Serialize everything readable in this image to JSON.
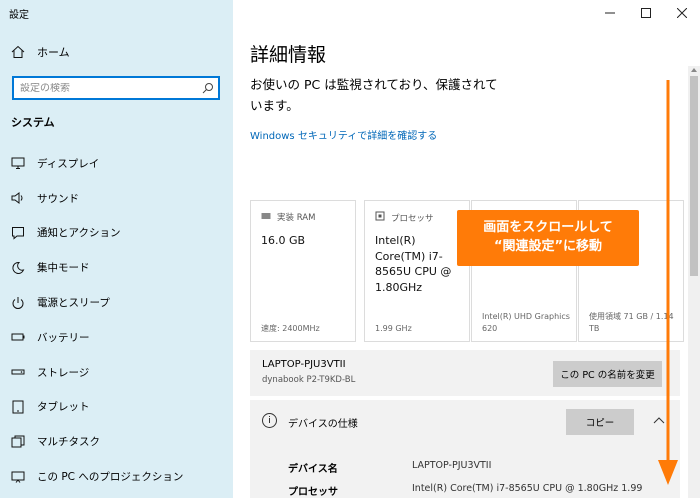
{
  "app": {
    "title": "設定"
  },
  "sidebar": {
    "home_label": "ホーム",
    "search_placeholder": "設定の検索",
    "section_title": "システム",
    "items": [
      {
        "label": "ディスプレイ",
        "icon": "monitor-icon"
      },
      {
        "label": "サウンド",
        "icon": "speaker-icon"
      },
      {
        "label": "通知とアクション",
        "icon": "notification-icon"
      },
      {
        "label": "集中モード",
        "icon": "moon-icon"
      },
      {
        "label": "電源とスリープ",
        "icon": "power-icon"
      },
      {
        "label": "バッテリー",
        "icon": "battery-icon"
      },
      {
        "label": "ストレージ",
        "icon": "storage-icon"
      },
      {
        "label": "タブレット",
        "icon": "tablet-icon"
      },
      {
        "label": "マルチタスク",
        "icon": "multitask-icon"
      },
      {
        "label": "この PC へのプロジェクション",
        "icon": "projection-icon"
      }
    ]
  },
  "main": {
    "title": "詳細情報",
    "status_text": "お使いの PC は監視されており、保護されています。",
    "security_link": "Windows セキュリティで詳細を確認する",
    "cards": [
      {
        "head": "実装 RAM",
        "icon": "ram-icon",
        "value": "16.0 GB",
        "sub": "速度: 2400MHz"
      },
      {
        "head": "プロセッサ",
        "icon": "processor-icon",
        "value": "Intel(R) Core(TM) i7-8565U CPU @ 1.80GHz",
        "sub": "1.99 GHz"
      },
      {
        "head": "",
        "icon": "",
        "value": "",
        "sub": "Intel(R) UHD Graphics 620"
      },
      {
        "head": "",
        "icon": "",
        "value": "",
        "sub": "使用領域 71 GB / 1.14 TB"
      }
    ],
    "callout": {
      "line1": "画面をスクロールして",
      "line2": "“関連設定”に移動"
    },
    "pc": {
      "name": "LAPTOP-PJU3VTII",
      "model": "dynabook P2-T9KD-BL",
      "rename_label": "この PC の名前を変更"
    },
    "spec": {
      "title": "デバイスの仕様",
      "copy_label": "コピー",
      "rows": [
        {
          "label": "デバイス名",
          "value": "LAPTOP-PJU3VTII"
        },
        {
          "label": "プロセッサ",
          "value": "Intel(R) Core(TM) i7-8565U CPU @ 1.80GHz   1.99"
        }
      ]
    }
  },
  "colors": {
    "accent": "#0078d7",
    "callout": "#ff7b08",
    "sidebar_bg": "#dbeef5",
    "link": "#0067b8"
  }
}
